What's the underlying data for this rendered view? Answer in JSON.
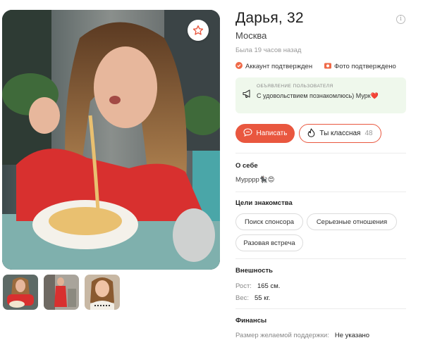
{
  "profile": {
    "name_age": "Дарья, 32",
    "city": "Москва",
    "last_seen": "Была 19 часов назад",
    "account_verified": "Аккаунт подтвержден",
    "photo_verified": "Фото подтверждено"
  },
  "announcement": {
    "title": "ОБЪЯВЛЕНИЕ ПОЛЬЗОВАТЕЛЯ",
    "text": "С удовольствием познакомлюсь) Мурк❤️"
  },
  "actions": {
    "write_label": "Написать",
    "cute_label": "Ты классная",
    "cute_count": "48"
  },
  "about": {
    "title": "О себе",
    "text": "Мурррр🐈‍⬛😍"
  },
  "goals": {
    "title": "Цели знакомства",
    "items": [
      "Поиск спонсора",
      "Серьезные отношения",
      "Разовая встреча"
    ]
  },
  "appearance": {
    "title": "Внешность",
    "height_label": "Рост:",
    "height_value": "165 см.",
    "weight_label": "Вес:",
    "weight_value": "55 кг."
  },
  "finance": {
    "title": "Финансы",
    "support_label": "Размер желаемой поддержки:",
    "support_value": "Не указано"
  },
  "colors": {
    "accent": "#e9573f",
    "announce_bg": "#eff8ec"
  },
  "icons": [
    "star-icon",
    "info-icon",
    "check-badge-icon",
    "camera-icon",
    "megaphone-icon",
    "chat-icon",
    "flame-icon"
  ]
}
